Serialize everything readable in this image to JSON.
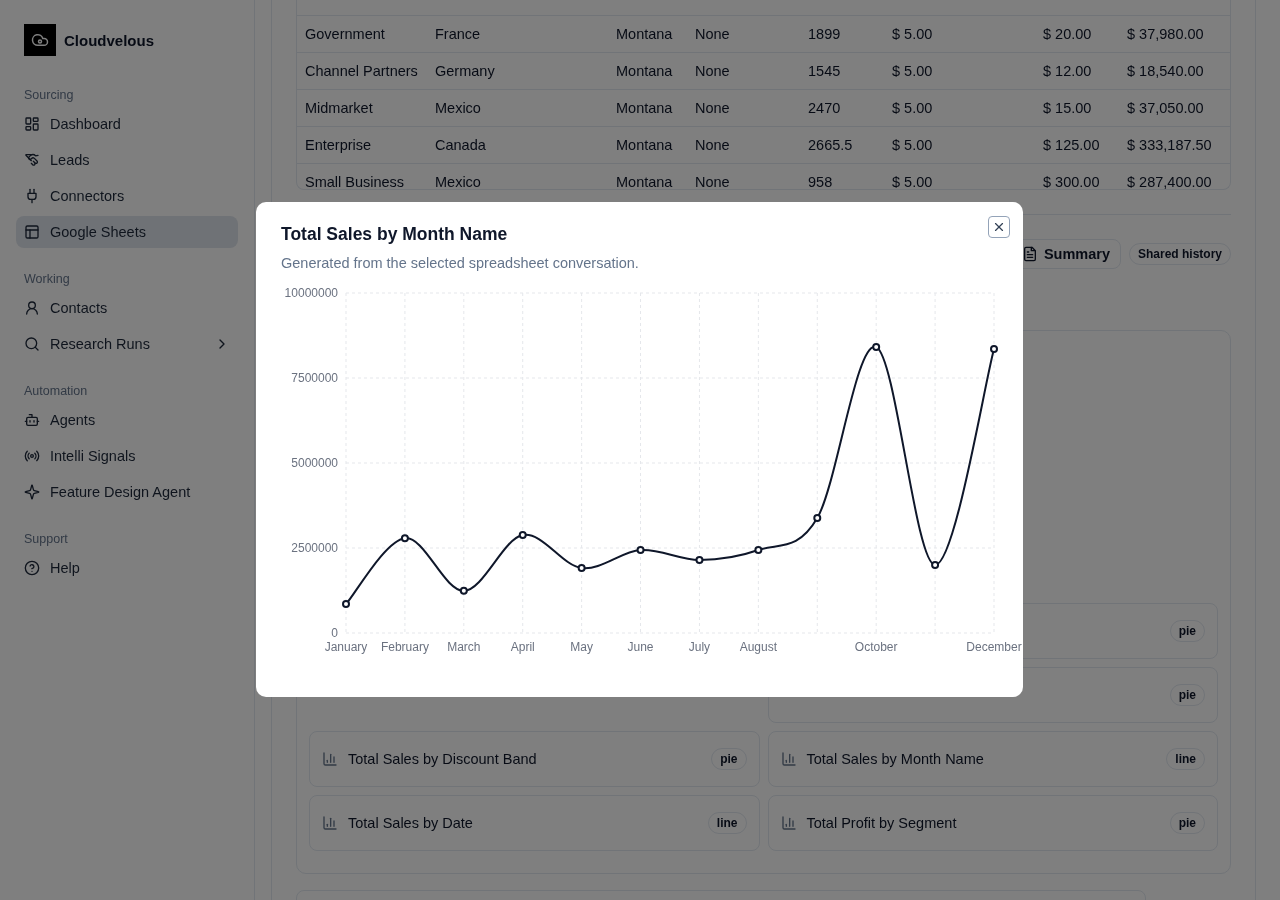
{
  "sidebar": {
    "brand": "Cloudvelous",
    "sections": [
      {
        "title": "Sourcing",
        "items": [
          {
            "label": "Dashboard",
            "selected": false,
            "has_submenu": false
          },
          {
            "label": "Leads",
            "selected": false,
            "has_submenu": false
          },
          {
            "label": "Connectors",
            "selected": false,
            "has_submenu": false
          },
          {
            "label": "Google Sheets",
            "selected": true,
            "has_submenu": false
          }
        ]
      },
      {
        "title": "Working",
        "items": [
          {
            "label": "Contacts",
            "selected": false,
            "has_submenu": false
          },
          {
            "label": "Research Runs",
            "selected": false,
            "has_submenu": true
          }
        ]
      },
      {
        "title": "Automation",
        "items": [
          {
            "label": "Agents",
            "selected": false,
            "has_submenu": false
          },
          {
            "label": "Intelli Signals",
            "selected": false,
            "has_submenu": false
          },
          {
            "label": "Feature Design Agent",
            "selected": false,
            "has_submenu": false
          }
        ]
      },
      {
        "title": "Support",
        "items": [
          {
            "label": "Help",
            "selected": false,
            "has_submenu": false
          }
        ]
      }
    ]
  },
  "table": {
    "rows": [
      [
        "Government",
        "France",
        "Montana",
        "None",
        "1899",
        "$ 5.00",
        "$ 20.00",
        "$ 37,980.00"
      ],
      [
        "Channel Partners",
        "Germany",
        "Montana",
        "None",
        "1545",
        "$ 5.00",
        "$ 12.00",
        "$ 18,540.00"
      ],
      [
        "Midmarket",
        "Mexico",
        "Montana",
        "None",
        "2470",
        "$ 5.00",
        "$ 15.00",
        "$ 37,050.00"
      ],
      [
        "Enterprise",
        "Canada",
        "Montana",
        "None",
        "2665.5",
        "$ 5.00",
        "$ 125.00",
        "$ 333,187.50"
      ],
      [
        "Small Business",
        "Mexico",
        "Montana",
        "None",
        "958",
        "$ 5.00",
        "$ 300.00",
        "$ 287,400.00"
      ]
    ]
  },
  "actions": [
    {
      "label": "Summary",
      "kind": "button"
    },
    {
      "label": "Shared history",
      "kind": "chip"
    }
  ],
  "charts_list": [
    {
      "badge": "pie"
    },
    {
      "badge": "pie"
    },
    {
      "title": "Total Sales by Discount Band",
      "badge": "pie"
    },
    {
      "title": "Total Sales by Month Name",
      "badge": "line"
    },
    {
      "title": "Total Sales by Date",
      "badge": "line"
    },
    {
      "title": "Total Profit by Segment",
      "badge": "pie"
    }
  ],
  "modal": {
    "title": "Total Sales by Month Name",
    "subtitle": "Generated from the selected spreadsheet conversation.",
    "chart_data": {
      "type": "line",
      "categories": [
        "January",
        "February",
        "March",
        "April",
        "May",
        "June",
        "July",
        "August",
        null,
        "October",
        null,
        "December"
      ],
      "grid": true,
      "ylim": [
        0,
        10000000
      ],
      "yticks": [
        0,
        2500000,
        5000000,
        7500000,
        10000000
      ],
      "series": [
        {
          "color": "#0f172a",
          "marker": "circle",
          "values": [
            850000,
            2790000,
            1240000,
            2880000,
            1910000,
            2440000,
            2150000,
            2440000,
            3380000,
            8410000,
            2000000,
            8350000
          ]
        }
      ]
    }
  }
}
